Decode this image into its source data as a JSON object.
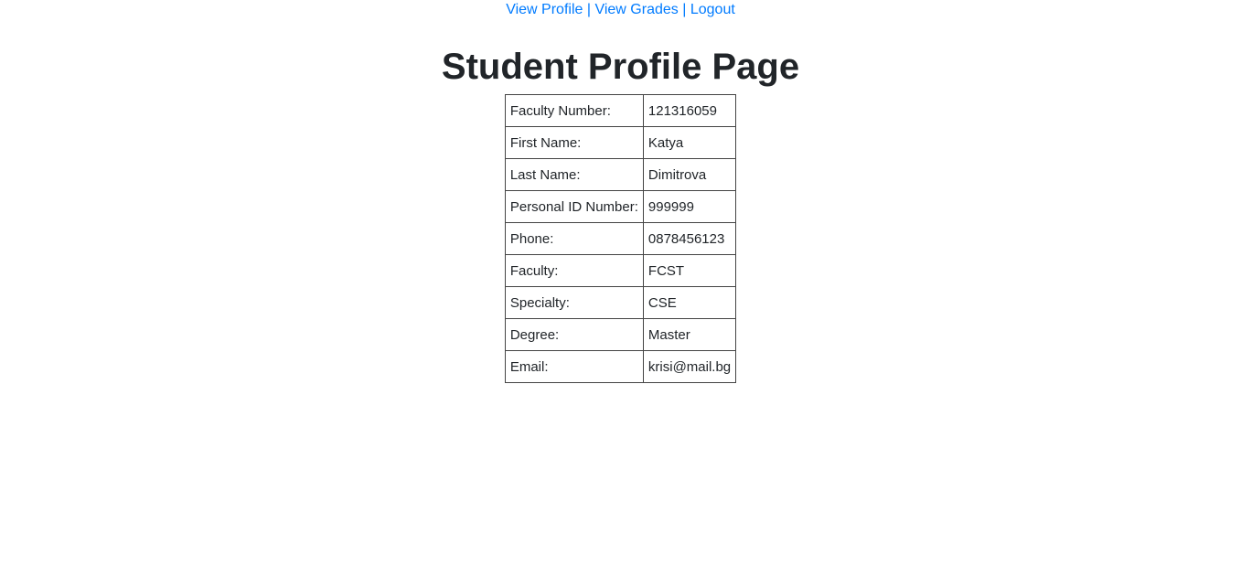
{
  "nav": {
    "view_profile": "View Profile",
    "separator": "|",
    "view_grades": "View Grades",
    "logout": "Logout"
  },
  "page_title": "Student Profile Page",
  "profile": {
    "rows": [
      {
        "label": "Faculty Number:",
        "value": "121316059"
      },
      {
        "label": "First Name:",
        "value": "Katya"
      },
      {
        "label": "Last Name:",
        "value": "Dimitrova"
      },
      {
        "label": "Personal ID Number:",
        "value": "999999"
      },
      {
        "label": "Phone:",
        "value": "0878456123"
      },
      {
        "label": "Faculty:",
        "value": "FCST"
      },
      {
        "label": "Specialty:",
        "value": "CSE"
      },
      {
        "label": "Degree:",
        "value": "Master"
      },
      {
        "label": "Email:",
        "value": "krisi@mail.bg"
      }
    ]
  },
  "colors": {
    "link": "#007bff",
    "text": "#212529",
    "border": "#444444"
  }
}
